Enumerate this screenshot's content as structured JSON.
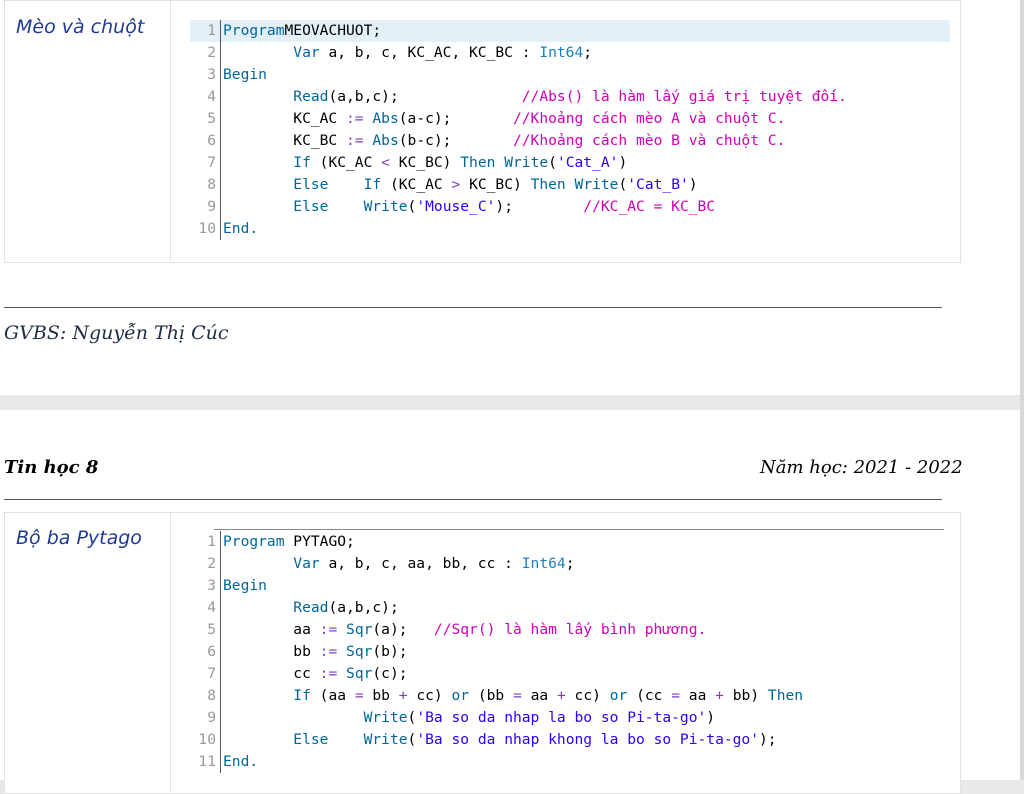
{
  "problem1": {
    "title": "Mèo và chuột",
    "lines": [
      {
        "n": "1",
        "t": [
          [
            "kw",
            "Program"
          ],
          [
            "",
            "MEOVACHUOT;"
          ]
        ]
      },
      {
        "n": "2",
        "t": [
          [
            "",
            "        "
          ],
          [
            "kw",
            "Var"
          ],
          [
            "",
            " a, b, c, KC_AC, KC_BC : "
          ],
          [
            "ty",
            "Int64"
          ],
          [
            "",
            ";"
          ]
        ]
      },
      {
        "n": "3",
        "t": [
          [
            "kw",
            "Begin"
          ]
        ]
      },
      {
        "n": "4",
        "t": [
          [
            "",
            "        "
          ],
          [
            "fn",
            "Read"
          ],
          [
            "",
            "(a,b,c);"
          ],
          [
            "",
            "              "
          ],
          [
            "cm",
            "//Abs() là hàm lấy giá trị tuyệt đối."
          ]
        ]
      },
      {
        "n": "5",
        "t": [
          [
            "",
            "        KC_AC "
          ],
          [
            "op",
            ":="
          ],
          [
            "",
            " "
          ],
          [
            "fn",
            "Abs"
          ],
          [
            "",
            "(a-c);       "
          ],
          [
            "cm",
            "//Khoảng cách mèo A và chuột C."
          ]
        ]
      },
      {
        "n": "6",
        "t": [
          [
            "",
            "        KC_BC "
          ],
          [
            "op",
            ":="
          ],
          [
            "",
            " "
          ],
          [
            "fn",
            "Abs"
          ],
          [
            "",
            "(b-c);       "
          ],
          [
            "cm",
            "//Khoảng cách mèo B và chuột C."
          ]
        ]
      },
      {
        "n": "7",
        "t": [
          [
            "",
            "        "
          ],
          [
            "kw",
            "If"
          ],
          [
            "",
            " (KC_AC "
          ],
          [
            "op",
            "<"
          ],
          [
            "",
            " KC_BC) "
          ],
          [
            "kw",
            "Then"
          ],
          [
            "",
            " "
          ],
          [
            "fn",
            "Write"
          ],
          [
            "",
            "("
          ],
          [
            "st",
            "'Cat_A'"
          ],
          [
            "",
            ")"
          ]
        ]
      },
      {
        "n": "8",
        "t": [
          [
            "",
            "        "
          ],
          [
            "kw",
            "Else"
          ],
          [
            "",
            "    "
          ],
          [
            "kw",
            "If"
          ],
          [
            "",
            " (KC_AC "
          ],
          [
            "op",
            ">"
          ],
          [
            "",
            " KC_BC) "
          ],
          [
            "kw",
            "Then"
          ],
          [
            "",
            " "
          ],
          [
            "fn",
            "Write"
          ],
          [
            "",
            "("
          ],
          [
            "st",
            "'Cat_B'"
          ],
          [
            "",
            ")"
          ]
        ]
      },
      {
        "n": "9",
        "t": [
          [
            "",
            "        "
          ],
          [
            "kw",
            "Else"
          ],
          [
            "",
            "    "
          ],
          [
            "fn",
            "Write"
          ],
          [
            "",
            "("
          ],
          [
            "st",
            "'Mouse_C'"
          ],
          [
            "",
            ");        "
          ],
          [
            "cm",
            "//KC_AC = KC_BC"
          ]
        ]
      },
      {
        "n": "10",
        "t": [
          [
            "kw",
            "End."
          ]
        ]
      }
    ]
  },
  "footer": {
    "teacher": "GVBS: Nguyễn Thị Cúc"
  },
  "header": {
    "subject": "Tin học 8",
    "year": "Năm học: 2021 - 2022"
  },
  "problem2": {
    "title": "Bộ ba Pytago",
    "lines": [
      {
        "n": "1",
        "t": [
          [
            "kw",
            "Program"
          ],
          [
            "",
            " PYTAGO;"
          ]
        ]
      },
      {
        "n": "2",
        "t": [
          [
            "",
            "        "
          ],
          [
            "kw",
            "Var"
          ],
          [
            "",
            " a, b, c, aa, bb, cc : "
          ],
          [
            "ty",
            "Int64"
          ],
          [
            "",
            ";"
          ]
        ]
      },
      {
        "n": "3",
        "t": [
          [
            "kw",
            "Begin"
          ]
        ]
      },
      {
        "n": "4",
        "t": [
          [
            "",
            "        "
          ],
          [
            "fn",
            "Read"
          ],
          [
            "",
            "(a,b,c);"
          ]
        ]
      },
      {
        "n": "5",
        "t": [
          [
            "",
            "        aa "
          ],
          [
            "op",
            ":="
          ],
          [
            "",
            " "
          ],
          [
            "fn",
            "Sqr"
          ],
          [
            "",
            "(a);   "
          ],
          [
            "cm",
            "//Sqr() là hàm lấy bình phương."
          ]
        ]
      },
      {
        "n": "6",
        "t": [
          [
            "",
            "        bb "
          ],
          [
            "op",
            ":="
          ],
          [
            "",
            " "
          ],
          [
            "fn",
            "Sqr"
          ],
          [
            "",
            "(b);"
          ]
        ]
      },
      {
        "n": "7",
        "t": [
          [
            "",
            "        cc "
          ],
          [
            "op",
            ":="
          ],
          [
            "",
            " "
          ],
          [
            "fn",
            "Sqr"
          ],
          [
            "",
            "(c);"
          ]
        ]
      },
      {
        "n": "8",
        "t": [
          [
            "",
            "        "
          ],
          [
            "kw",
            "If"
          ],
          [
            "",
            " (aa "
          ],
          [
            "op",
            "="
          ],
          [
            "",
            " bb "
          ],
          [
            "op",
            "+"
          ],
          [
            "",
            " cc) "
          ],
          [
            "kw",
            "or"
          ],
          [
            "",
            " (bb "
          ],
          [
            "op",
            "="
          ],
          [
            "",
            " aa "
          ],
          [
            "op",
            "+"
          ],
          [
            "",
            " cc) "
          ],
          [
            "kw",
            "or"
          ],
          [
            "",
            " (cc "
          ],
          [
            "op",
            "="
          ],
          [
            "",
            " aa "
          ],
          [
            "op",
            "+"
          ],
          [
            "",
            " bb) "
          ],
          [
            "kw",
            "Then"
          ]
        ]
      },
      {
        "n": "9",
        "t": [
          [
            "",
            "                "
          ],
          [
            "fn",
            "Write"
          ],
          [
            "",
            "("
          ],
          [
            "st",
            "'Ba so da nhap la bo so Pi-ta-go'"
          ],
          [
            "",
            ")"
          ]
        ]
      },
      {
        "n": "10",
        "t": [
          [
            "",
            "        "
          ],
          [
            "kw",
            "Else"
          ],
          [
            "",
            "    "
          ],
          [
            "fn",
            "Write"
          ],
          [
            "",
            "("
          ],
          [
            "st",
            "'Ba so da nhap khong la bo so Pi-ta-go'"
          ],
          [
            "",
            ");"
          ]
        ]
      },
      {
        "n": "11",
        "t": [
          [
            "kw",
            "End."
          ]
        ]
      }
    ]
  }
}
